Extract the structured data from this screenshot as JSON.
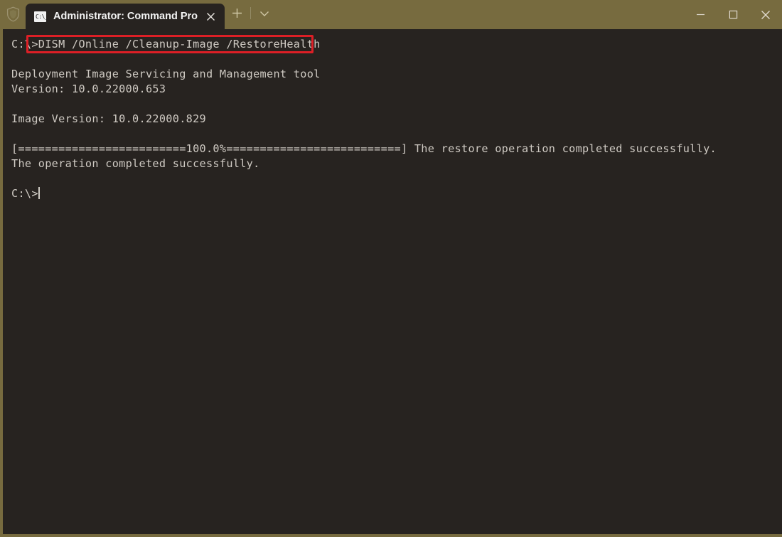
{
  "window": {
    "shield_icon": "shield-icon",
    "controls": {
      "minimize": "minimize-icon",
      "maximize": "maximize-icon",
      "close": "close-icon"
    }
  },
  "tabbar": {
    "tabs": [
      {
        "icon_label": "C:\\_",
        "title": "Administrator: Command Pro",
        "close_label": "✕"
      }
    ],
    "new_tab_label": "+",
    "dropdown_label": "⌄"
  },
  "terminal": {
    "colors": {
      "background": "#272320",
      "foreground": "#cfcac3",
      "titlebar": "#776b3f",
      "highlight": "#dd1f26"
    },
    "prompt": "C:\\>",
    "command": "DISM /Online /Cleanup-Image /RestoreHealth",
    "lines": [
      "C:\\>DISM /Online /Cleanup-Image /RestoreHealth",
      "",
      "Deployment Image Servicing and Management tool",
      "Version: 10.0.22000.653",
      "",
      "Image Version: 10.0.22000.829",
      "",
      "[=========================100.0%==========================] The restore operation completed successfully.",
      "The operation completed successfully.",
      "",
      "C:\\>"
    ],
    "progress": {
      "percent_label": "100.0%",
      "percent_value": 100,
      "bar_open": "[",
      "bar_close": "]",
      "status": "The restore operation completed successfully."
    },
    "final_status": "The operation completed successfully.",
    "final_prompt": "C:\\>",
    "cursor_visible": true
  }
}
